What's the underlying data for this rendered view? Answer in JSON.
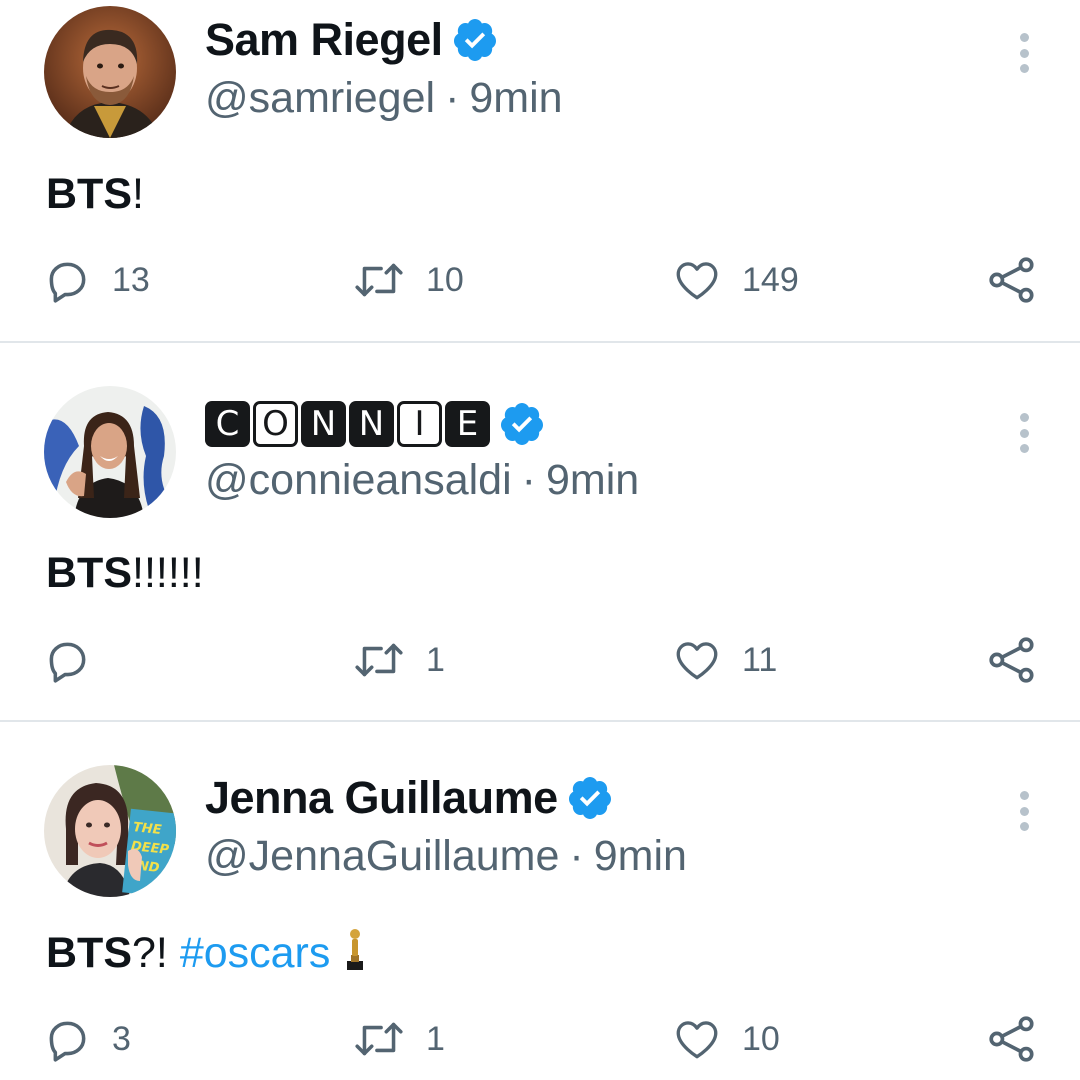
{
  "tweets": [
    {
      "display_name": "Sam Riegel",
      "handle": "@samriegel",
      "separator": "·",
      "time": "9min",
      "text_bold": "BTS",
      "text_rest": "!",
      "hashtag": "",
      "verified": true,
      "replies": "13",
      "retweets": "10",
      "likes": "149"
    },
    {
      "display_name_letters": [
        "C",
        "O",
        "N",
        "N",
        "I",
        "E"
      ],
      "handle": "@connieansaldi",
      "separator": "·",
      "time": "9min",
      "text_bold": "BTS",
      "text_rest": "!!!!!!",
      "hashtag": "",
      "verified": true,
      "replies": "",
      "retweets": "1",
      "likes": "11"
    },
    {
      "display_name": "Jenna Guillaume",
      "handle": "@JennaGuillaume",
      "separator": "·",
      "time": "9min",
      "text_bold": "BTS",
      "text_rest": "?! ",
      "hashtag": "#oscars",
      "emoji": "trophy",
      "verified": true,
      "replies": "3",
      "retweets": "1",
      "likes": "10",
      "avatar_book_text": "THE DEEP END"
    }
  ],
  "icons": {
    "reply": "reply-icon",
    "retweet": "retweet-icon",
    "like": "heart-icon",
    "share": "share-icon",
    "more": "more-options-icon",
    "verified": "verified-badge-icon"
  },
  "colors": {
    "text": "#0f1419",
    "secondary": "#536471",
    "accent": "#1d9bf0",
    "divider": "#e1e6ea"
  }
}
